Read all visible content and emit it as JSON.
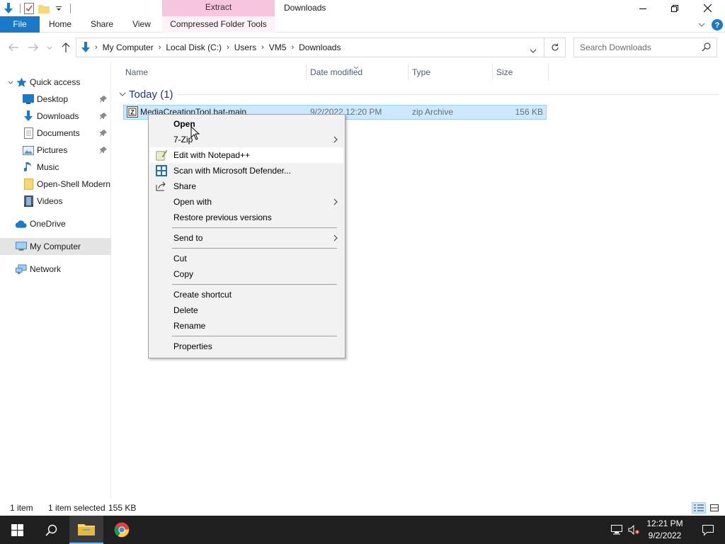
{
  "window": {
    "title": "Downloads",
    "contextual_tab_header": "Extract"
  },
  "ribbon": {
    "tabs": [
      "File",
      "Home",
      "Share",
      "View",
      "Compressed Folder Tools"
    ]
  },
  "address": {
    "breadcrumbs": [
      "My Computer",
      "Local Disk (C:)",
      "Users",
      "VM5",
      "Downloads"
    ],
    "search_placeholder": "Search Downloads"
  },
  "nav": {
    "items": [
      {
        "label": "Quick access",
        "icon": "star-icon"
      },
      {
        "label": "Desktop",
        "icon": "desktop-icon",
        "pinned": true
      },
      {
        "label": "Downloads",
        "icon": "download-arrow-icon",
        "pinned": true
      },
      {
        "label": "Documents",
        "icon": "documents-icon",
        "pinned": true
      },
      {
        "label": "Pictures",
        "icon": "pictures-icon",
        "pinned": true
      },
      {
        "label": "Music",
        "icon": "music-icon"
      },
      {
        "label": "Open-Shell Modern",
        "icon": "folder-icon"
      },
      {
        "label": "Videos",
        "icon": "videos-icon"
      },
      {
        "label": "OneDrive",
        "icon": "cloud-icon"
      },
      {
        "label": "My Computer",
        "icon": "computer-icon",
        "selected": true
      },
      {
        "label": "Network",
        "icon": "network-icon"
      }
    ]
  },
  "columns": [
    "Name",
    "Date modified",
    "Type",
    "Size"
  ],
  "group": {
    "label": "Today (1)"
  },
  "file": {
    "name": "MediaCreationTool.bat-main",
    "date": "9/2/2022 12:20 PM",
    "type": "zip Archive",
    "size": "156 KB"
  },
  "context_menu": {
    "items": [
      {
        "label": "Open",
        "bold": true
      },
      {
        "label": "7-Zip",
        "submenu": true
      },
      {
        "label": "Edit with Notepad++",
        "icon": "notepadpp-icon",
        "hover": true
      },
      {
        "label": "Scan with Microsoft Defender...",
        "icon": "defender-shield-icon"
      },
      {
        "label": "Share",
        "icon": "share-icon"
      },
      {
        "label": "Open with",
        "submenu": true
      },
      {
        "label": "Restore previous versions"
      },
      {
        "label": "Send to",
        "submenu": true
      },
      {
        "label": "Cut"
      },
      {
        "label": "Copy"
      },
      {
        "label": "Create shortcut"
      },
      {
        "label": "Delete"
      },
      {
        "label": "Rename"
      },
      {
        "label": "Properties"
      }
    ]
  },
  "status": {
    "item_count": "1 item",
    "selected": "1 item selected",
    "selected_size": "155 KB"
  },
  "taskbar": {
    "time": "12:21 PM",
    "date": "9/2/2022"
  },
  "colors": {
    "accent": "#1979ca",
    "selection": "#cce8ff",
    "context_tab": "#f7c5dd",
    "taskbar": "#1f1f1f"
  }
}
